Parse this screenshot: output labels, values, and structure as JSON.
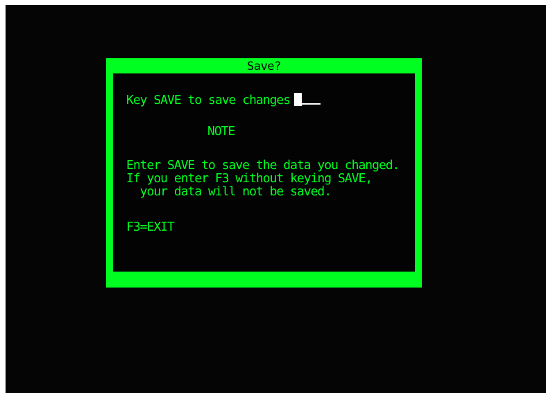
{
  "dialog": {
    "title": "Save?",
    "prompt_label": "Key SAVE to save changes",
    "input_value": "",
    "note_heading": "NOTE",
    "message_lines": [
      "Enter SAVE to save the data you changed.",
      "If you enter F3 without keying SAVE,",
      "  your data will not be saved."
    ],
    "function_keys": "F3=EXIT"
  },
  "colors": {
    "screen_background": "#050505",
    "terminal_green": "#00ff21",
    "cursor": "#ffffff"
  }
}
